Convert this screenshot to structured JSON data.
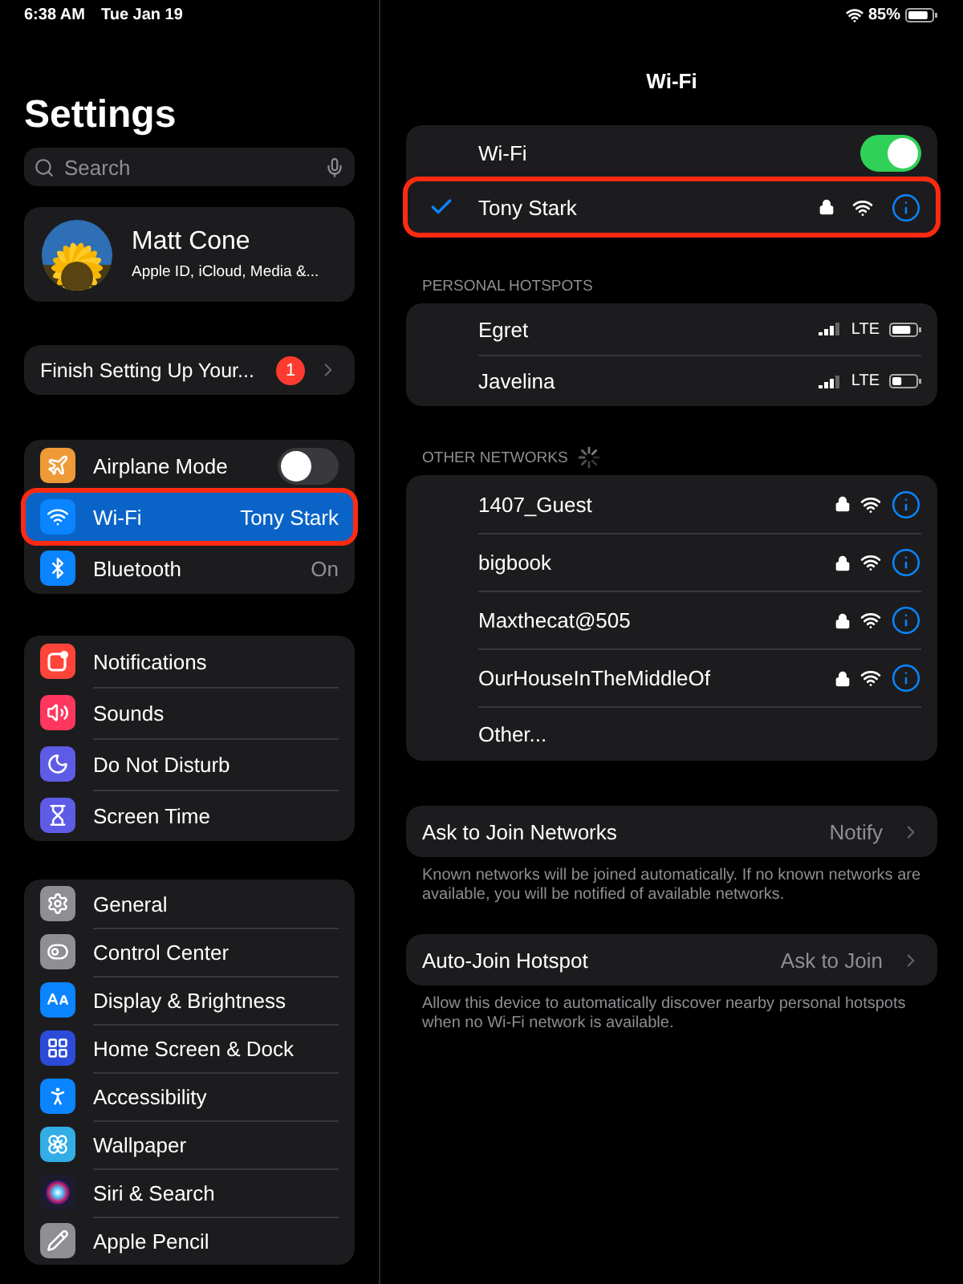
{
  "status_bar": {
    "time": "6:38 AM",
    "date": "Tue Jan 19",
    "battery": "85%"
  },
  "sidebar": {
    "title": "Settings",
    "search": {
      "placeholder": "Search"
    },
    "profile": {
      "name": "Matt Cone",
      "subtitle": "Apple ID, iCloud, Media &..."
    },
    "setup": {
      "label": "Finish Setting Up Your...",
      "badge": "1"
    },
    "groups": [
      [
        {
          "label": "Airplane Mode",
          "color": "#f09a37",
          "kind": "toggle",
          "on": false,
          "selected": false
        },
        {
          "label": "Wi-Fi",
          "value": "Tony Stark",
          "color": "#0a84ff",
          "kind": "link",
          "selected": true,
          "highlighted": true
        },
        {
          "label": "Bluetooth",
          "value": "On",
          "color": "#0a84ff",
          "kind": "link",
          "selected": false
        }
      ],
      [
        {
          "label": "Notifications",
          "color": "#ff453a",
          "kind": "link",
          "selected": false
        },
        {
          "label": "Sounds",
          "color": "#ff375f",
          "kind": "link",
          "selected": false
        },
        {
          "label": "Do Not Disturb",
          "color": "#5e5ce6",
          "kind": "link",
          "selected": false
        },
        {
          "label": "Screen Time",
          "color": "#5e5ce6",
          "kind": "link",
          "selected": false
        }
      ],
      [
        {
          "label": "General",
          "color": "#8e8e93",
          "kind": "link",
          "selected": false
        },
        {
          "label": "Control Center",
          "color": "#8e8e93",
          "kind": "link",
          "selected": false
        },
        {
          "label": "Display & Brightness",
          "color": "#0a84ff",
          "kind": "link",
          "selected": false
        },
        {
          "label": "Home Screen & Dock",
          "color": "#2c4bd8",
          "kind": "link",
          "selected": false
        },
        {
          "label": "Accessibility",
          "color": "#0a84ff",
          "kind": "link",
          "selected": false
        },
        {
          "label": "Wallpaper",
          "color": "#32ade6",
          "kind": "link",
          "selected": false
        },
        {
          "label": "Siri & Search",
          "color": "#1c1c2e",
          "kind": "link",
          "selected": false
        },
        {
          "label": "Apple Pencil",
          "color": "#8e8e93",
          "kind": "link",
          "selected": false
        }
      ]
    ]
  },
  "detail": {
    "title": "Wi-Fi",
    "wifi_toggle": {
      "label": "Wi-Fi",
      "on": true
    },
    "connected": {
      "name": "Tony Stark",
      "selected": true,
      "locked": true,
      "highlighted": true
    },
    "hotspots_header": "PERSONAL HOTSPOTS",
    "hotspots": [
      {
        "name": "Egret",
        "network": "LTE"
      },
      {
        "name": "Javelina",
        "network": "LTE"
      }
    ],
    "other_header": "OTHER NETWORKS",
    "networks": [
      {
        "name": "1407_Guest",
        "locked": true
      },
      {
        "name": "bigbook",
        "locked": true
      },
      {
        "name": "Maxthecat@505",
        "locked": true
      },
      {
        "name": "OurHouseInTheMiddleOf",
        "locked": true
      }
    ],
    "other_row": "Other...",
    "settings": [
      {
        "label": "Ask to Join Networks",
        "value": "Notify",
        "note": "Known networks will be joined automatically. If no known networks are available, you will be notified of available networks."
      },
      {
        "label": "Auto-Join Hotspot",
        "value": "Ask to Join",
        "note": "Allow this device to automatically discover nearby personal hotspots when no Wi-Fi network is available."
      }
    ]
  }
}
